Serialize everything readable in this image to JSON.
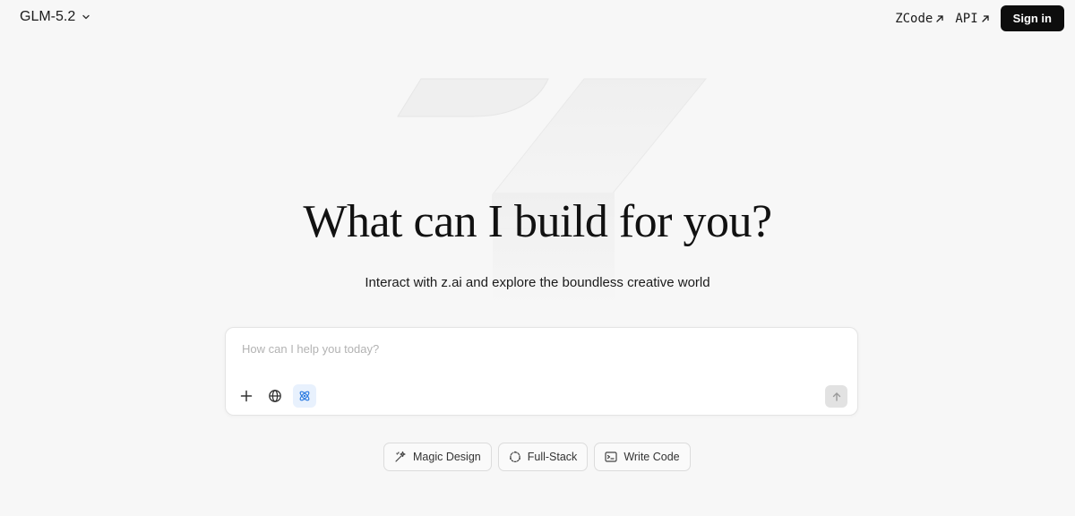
{
  "header": {
    "model_name": "GLM-5.2",
    "links": [
      {
        "label": "ZCode"
      },
      {
        "label": "API"
      }
    ],
    "sign_in_label": "Sign in"
  },
  "hero": {
    "title": "What can I build for you?",
    "subtitle": "Interact with z.ai and explore the boundless creative world"
  },
  "chat": {
    "placeholder": "How can I help you today?",
    "value": "",
    "tools": [
      "plus-icon",
      "globe-icon",
      "atom-icon"
    ],
    "send_icon": "arrow-up-icon"
  },
  "quick_actions": [
    {
      "label": "Magic Design",
      "icon": "magic-wand-icon"
    },
    {
      "label": "Full-Stack",
      "icon": "cycle-icon"
    },
    {
      "label": "Write Code",
      "icon": "terminal-icon"
    }
  ],
  "colors": {
    "background": "#f7f7f7",
    "sign_in_bg": "#0d0d0d",
    "agent_tool_accent": "#2f7de1",
    "agent_tool_bg": "#e8f1fd"
  }
}
